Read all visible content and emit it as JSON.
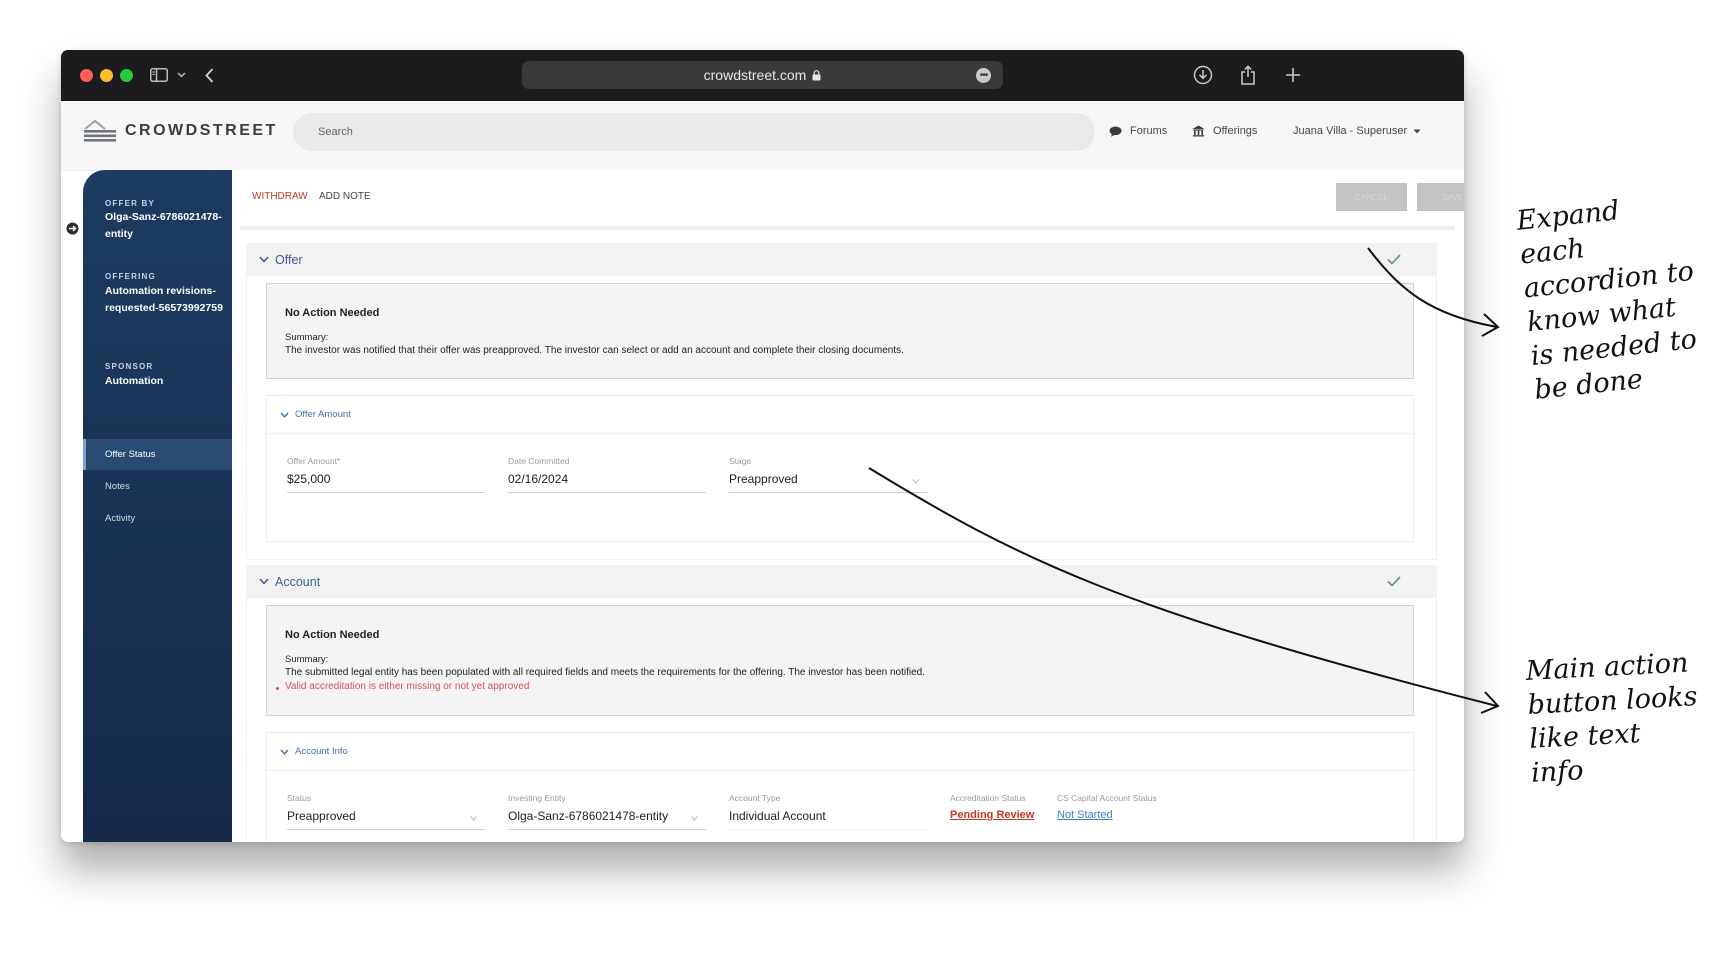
{
  "browser": {
    "url": "crowdstreet.com"
  },
  "header": {
    "brand": "CROWDSTREET",
    "search_placeholder": "Search",
    "forums_label": "Forums",
    "offerings_label": "Offerings",
    "user_label": "Juana Villa - Superuser"
  },
  "sidebar": {
    "offer_by_label": "OFFER BY",
    "offer_by_value": "Olga-Sanz-6786021478-entity",
    "offering_label": "OFFERING",
    "offering_value": "Automation revisions-requested-56573992759",
    "sponsor_label": "SPONSOR",
    "sponsor_value": "Automation",
    "items": [
      {
        "label": "Offer Status",
        "active": true
      },
      {
        "label": "Notes",
        "active": false
      },
      {
        "label": "Activity",
        "active": false
      }
    ]
  },
  "toolbar": {
    "withdraw_label": "WITHDRAW",
    "add_note_label": "ADD NOTE",
    "cancel_label": "CANCEL",
    "save_label": "SAVE"
  },
  "offer_section": {
    "title": "Offer",
    "notice": {
      "heading": "No Action Needed",
      "summary_label": "Summary:",
      "text": "The investor was notified that their offer was preapproved. The investor can select or add an account and complete their closing documents."
    },
    "subsection_title": "Offer Amount",
    "fields": {
      "offer_amount": {
        "label": "Offer Amount*",
        "value": "$25,000"
      },
      "date_committed": {
        "label": "Date Committed",
        "value": "02/16/2024"
      },
      "stage": {
        "label": "Stage",
        "value": "Preapproved"
      }
    }
  },
  "account_section": {
    "title": "Account",
    "notice": {
      "heading": "No Action Needed",
      "summary_label": "Summary:",
      "text": "The submitted legal entity has been populated with all required fields and meets the requirements for the offering. The investor has been notified.",
      "error": "Valid accreditation is either missing or not yet approved"
    },
    "subsection_title": "Account Info",
    "fields": {
      "status": {
        "label": "Status",
        "value": "Preapproved"
      },
      "investing_entity": {
        "label": "Investing Entity",
        "value": "Olga-Sanz-6786021478-entity"
      },
      "account_type": {
        "label": "Account Type",
        "value": "Individual Account"
      },
      "accreditation_status": {
        "label": "Accreditation Status",
        "value": "Pending Review"
      },
      "cs_capital_account_status": {
        "label": "CS Capital Account Status",
        "value": "Not Started"
      }
    }
  },
  "annotations": {
    "note_1": "Expand\neach\naccordion to\nknow what\nis needed to\nbe done",
    "note_2": "Main action\nbutton looks\nlike text\ninfo"
  },
  "colors": {
    "sidebar": "#1d3b62",
    "accent_blue": "#3d6fa8",
    "error_red": "#d9534f",
    "withdraw_red": "#c0392b",
    "check_green": "#5a9a5e"
  }
}
